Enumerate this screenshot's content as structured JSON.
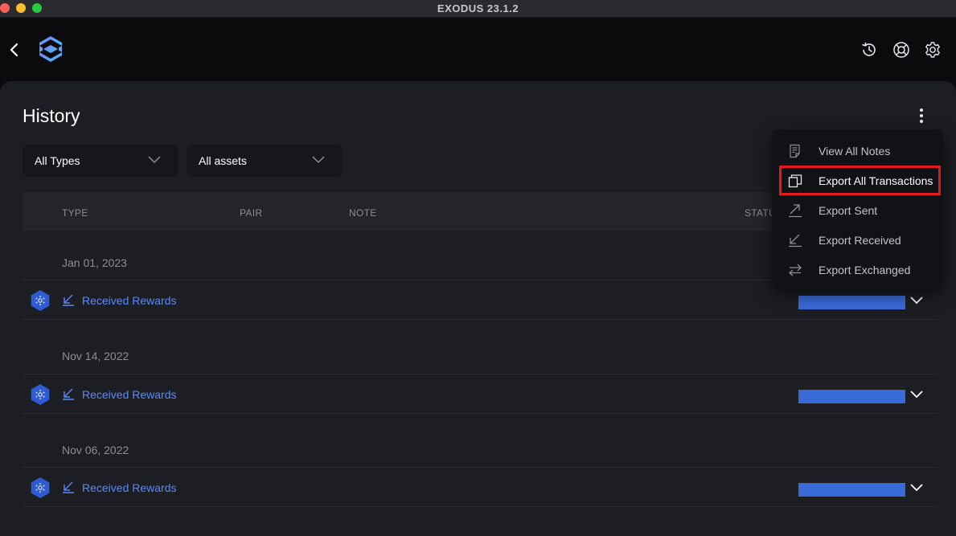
{
  "window": {
    "title": "EXODUS 23.1.2"
  },
  "topbar": {
    "icons": [
      "back-chevron-icon",
      "exodus-logo",
      "history-icon",
      "help-lifebuoy-icon",
      "settings-gear-icon"
    ]
  },
  "page": {
    "title": "History"
  },
  "filters": {
    "types": {
      "selected": "All Types"
    },
    "assets": {
      "selected": "All assets"
    }
  },
  "table": {
    "headers": {
      "type": "TYPE",
      "pair": "PAIR",
      "note": "NOTE",
      "status": "STATU"
    }
  },
  "groups": [
    {
      "date": "Jan 01, 2023",
      "rows": [
        {
          "type": "Received Rewards"
        }
      ]
    },
    {
      "date": "Nov 14, 2022",
      "rows": [
        {
          "type": "Received Rewards"
        }
      ]
    },
    {
      "date": "Nov 06, 2022",
      "rows": [
        {
          "type": "Received Rewards"
        }
      ]
    }
  ],
  "menu": {
    "items": [
      {
        "label": "View All Notes",
        "icon": "notes-icon"
      },
      {
        "label": "Export All Transactions",
        "icon": "copy-icon"
      },
      {
        "label": "Export Sent",
        "icon": "arrow-up-right-icon"
      },
      {
        "label": "Export Received",
        "icon": "arrow-down-left-icon"
      },
      {
        "label": "Export Exchanged",
        "icon": "exchange-arrows-icon"
      }
    ]
  },
  "colors": {
    "accent_blue": "#5b8af5",
    "status_bar": "#3a6ad8",
    "highlight_red": "#e4191c",
    "panel_bg": "#1c1e24"
  }
}
